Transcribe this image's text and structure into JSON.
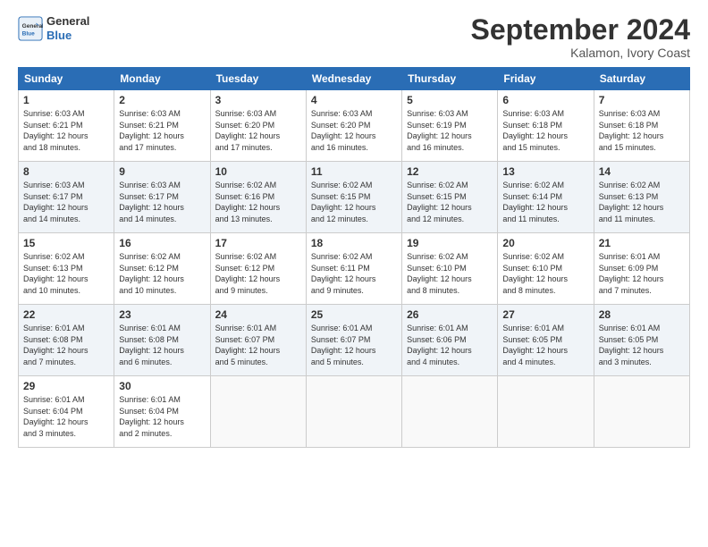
{
  "logo": {
    "line1": "General",
    "line2": "Blue"
  },
  "title": "September 2024",
  "location": "Kalamon, Ivory Coast",
  "days_header": [
    "Sunday",
    "Monday",
    "Tuesday",
    "Wednesday",
    "Thursday",
    "Friday",
    "Saturday"
  ],
  "weeks": [
    [
      {
        "day": "1",
        "sunrise": "6:03 AM",
        "sunset": "6:21 PM",
        "daylight": "12 hours and 18 minutes."
      },
      {
        "day": "2",
        "sunrise": "6:03 AM",
        "sunset": "6:21 PM",
        "daylight": "12 hours and 17 minutes."
      },
      {
        "day": "3",
        "sunrise": "6:03 AM",
        "sunset": "6:20 PM",
        "daylight": "12 hours and 17 minutes."
      },
      {
        "day": "4",
        "sunrise": "6:03 AM",
        "sunset": "6:20 PM",
        "daylight": "12 hours and 16 minutes."
      },
      {
        "day": "5",
        "sunrise": "6:03 AM",
        "sunset": "6:19 PM",
        "daylight": "12 hours and 16 minutes."
      },
      {
        "day": "6",
        "sunrise": "6:03 AM",
        "sunset": "6:18 PM",
        "daylight": "12 hours and 15 minutes."
      },
      {
        "day": "7",
        "sunrise": "6:03 AM",
        "sunset": "6:18 PM",
        "daylight": "12 hours and 15 minutes."
      }
    ],
    [
      {
        "day": "8",
        "sunrise": "6:03 AM",
        "sunset": "6:17 PM",
        "daylight": "12 hours and 14 minutes."
      },
      {
        "day": "9",
        "sunrise": "6:03 AM",
        "sunset": "6:17 PM",
        "daylight": "12 hours and 14 minutes."
      },
      {
        "day": "10",
        "sunrise": "6:02 AM",
        "sunset": "6:16 PM",
        "daylight": "12 hours and 13 minutes."
      },
      {
        "day": "11",
        "sunrise": "6:02 AM",
        "sunset": "6:15 PM",
        "daylight": "12 hours and 12 minutes."
      },
      {
        "day": "12",
        "sunrise": "6:02 AM",
        "sunset": "6:15 PM",
        "daylight": "12 hours and 12 minutes."
      },
      {
        "day": "13",
        "sunrise": "6:02 AM",
        "sunset": "6:14 PM",
        "daylight": "12 hours and 11 minutes."
      },
      {
        "day": "14",
        "sunrise": "6:02 AM",
        "sunset": "6:13 PM",
        "daylight": "12 hours and 11 minutes."
      }
    ],
    [
      {
        "day": "15",
        "sunrise": "6:02 AM",
        "sunset": "6:13 PM",
        "daylight": "12 hours and 10 minutes."
      },
      {
        "day": "16",
        "sunrise": "6:02 AM",
        "sunset": "6:12 PM",
        "daylight": "12 hours and 10 minutes."
      },
      {
        "day": "17",
        "sunrise": "6:02 AM",
        "sunset": "6:12 PM",
        "daylight": "12 hours and 9 minutes."
      },
      {
        "day": "18",
        "sunrise": "6:02 AM",
        "sunset": "6:11 PM",
        "daylight": "12 hours and 9 minutes."
      },
      {
        "day": "19",
        "sunrise": "6:02 AM",
        "sunset": "6:10 PM",
        "daylight": "12 hours and 8 minutes."
      },
      {
        "day": "20",
        "sunrise": "6:02 AM",
        "sunset": "6:10 PM",
        "daylight": "12 hours and 8 minutes."
      },
      {
        "day": "21",
        "sunrise": "6:01 AM",
        "sunset": "6:09 PM",
        "daylight": "12 hours and 7 minutes."
      }
    ],
    [
      {
        "day": "22",
        "sunrise": "6:01 AM",
        "sunset": "6:08 PM",
        "daylight": "12 hours and 7 minutes."
      },
      {
        "day": "23",
        "sunrise": "6:01 AM",
        "sunset": "6:08 PM",
        "daylight": "12 hours and 6 minutes."
      },
      {
        "day": "24",
        "sunrise": "6:01 AM",
        "sunset": "6:07 PM",
        "daylight": "12 hours and 5 minutes."
      },
      {
        "day": "25",
        "sunrise": "6:01 AM",
        "sunset": "6:07 PM",
        "daylight": "12 hours and 5 minutes."
      },
      {
        "day": "26",
        "sunrise": "6:01 AM",
        "sunset": "6:06 PM",
        "daylight": "12 hours and 4 minutes."
      },
      {
        "day": "27",
        "sunrise": "6:01 AM",
        "sunset": "6:05 PM",
        "daylight": "12 hours and 4 minutes."
      },
      {
        "day": "28",
        "sunrise": "6:01 AM",
        "sunset": "6:05 PM",
        "daylight": "12 hours and 3 minutes."
      }
    ],
    [
      {
        "day": "29",
        "sunrise": "6:01 AM",
        "sunset": "6:04 PM",
        "daylight": "12 hours and 3 minutes."
      },
      {
        "day": "30",
        "sunrise": "6:01 AM",
        "sunset": "6:04 PM",
        "daylight": "12 hours and 2 minutes."
      },
      null,
      null,
      null,
      null,
      null
    ]
  ]
}
